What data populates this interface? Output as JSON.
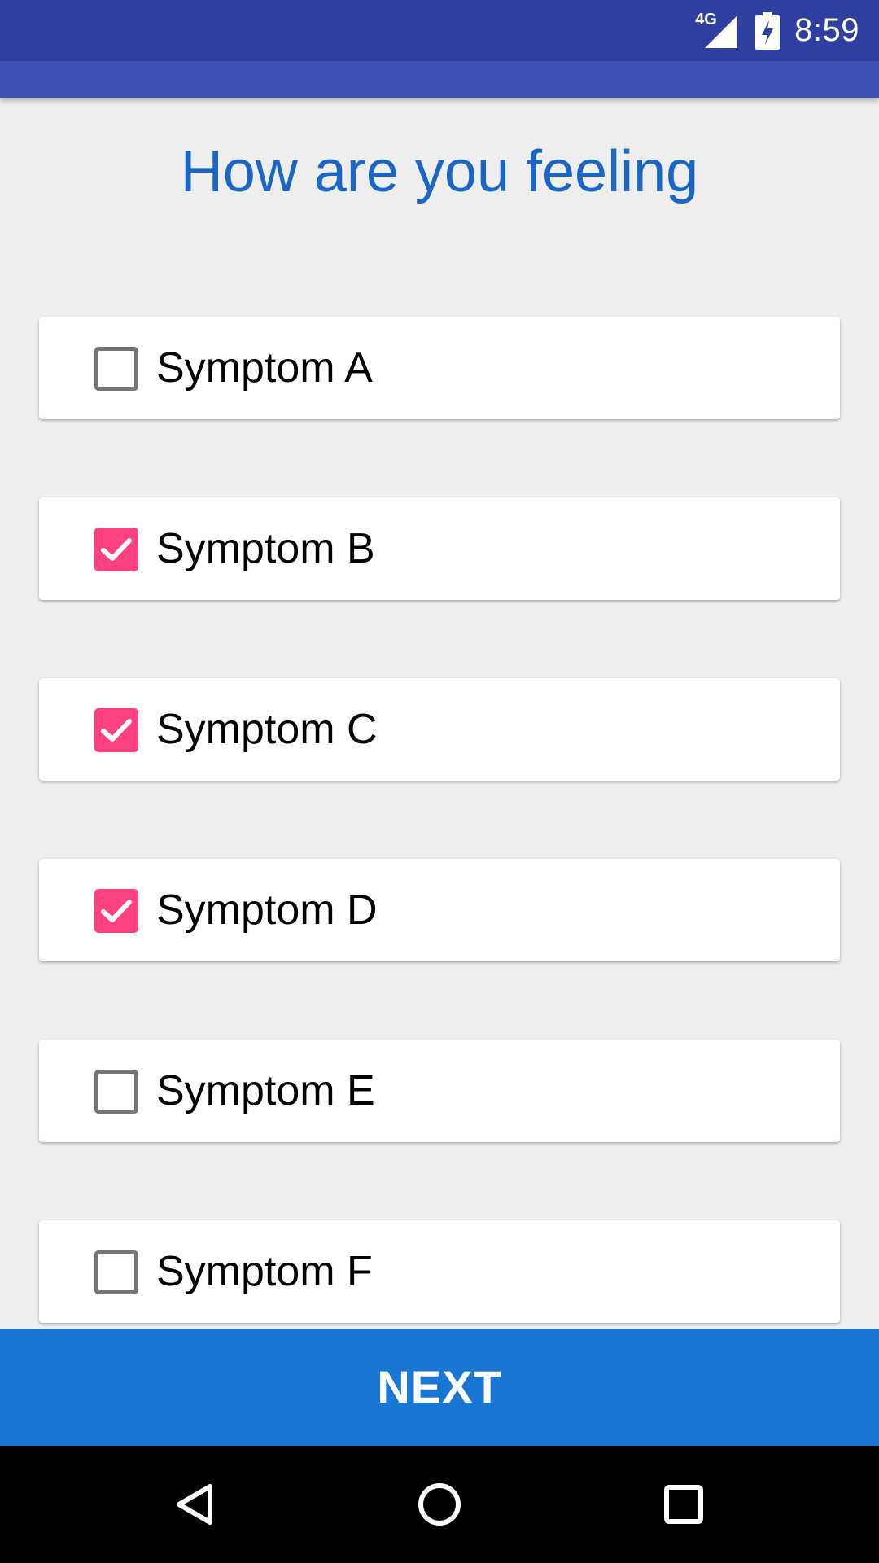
{
  "status_bar": {
    "network": "4G",
    "time": "8:59",
    "icons": [
      "signal-icon",
      "battery-charging-icon"
    ]
  },
  "page": {
    "title": "How are you feeling"
  },
  "symptoms": [
    {
      "label": "Symptom A",
      "checked": false
    },
    {
      "label": "Symptom B",
      "checked": true
    },
    {
      "label": "Symptom C",
      "checked": true
    },
    {
      "label": "Symptom D",
      "checked": true
    },
    {
      "label": "Symptom E",
      "checked": false
    },
    {
      "label": "Symptom F",
      "checked": false
    }
  ],
  "actions": {
    "next_label": "NEXT"
  },
  "nav": {
    "icons": [
      "back-icon",
      "home-icon",
      "recents-icon"
    ]
  },
  "colors": {
    "status_bar": "#303f9f",
    "app_bar": "#3f51b5",
    "title": "#1a66c6",
    "checkbox_checked": "#ff4081",
    "next_button": "#1976d2"
  }
}
